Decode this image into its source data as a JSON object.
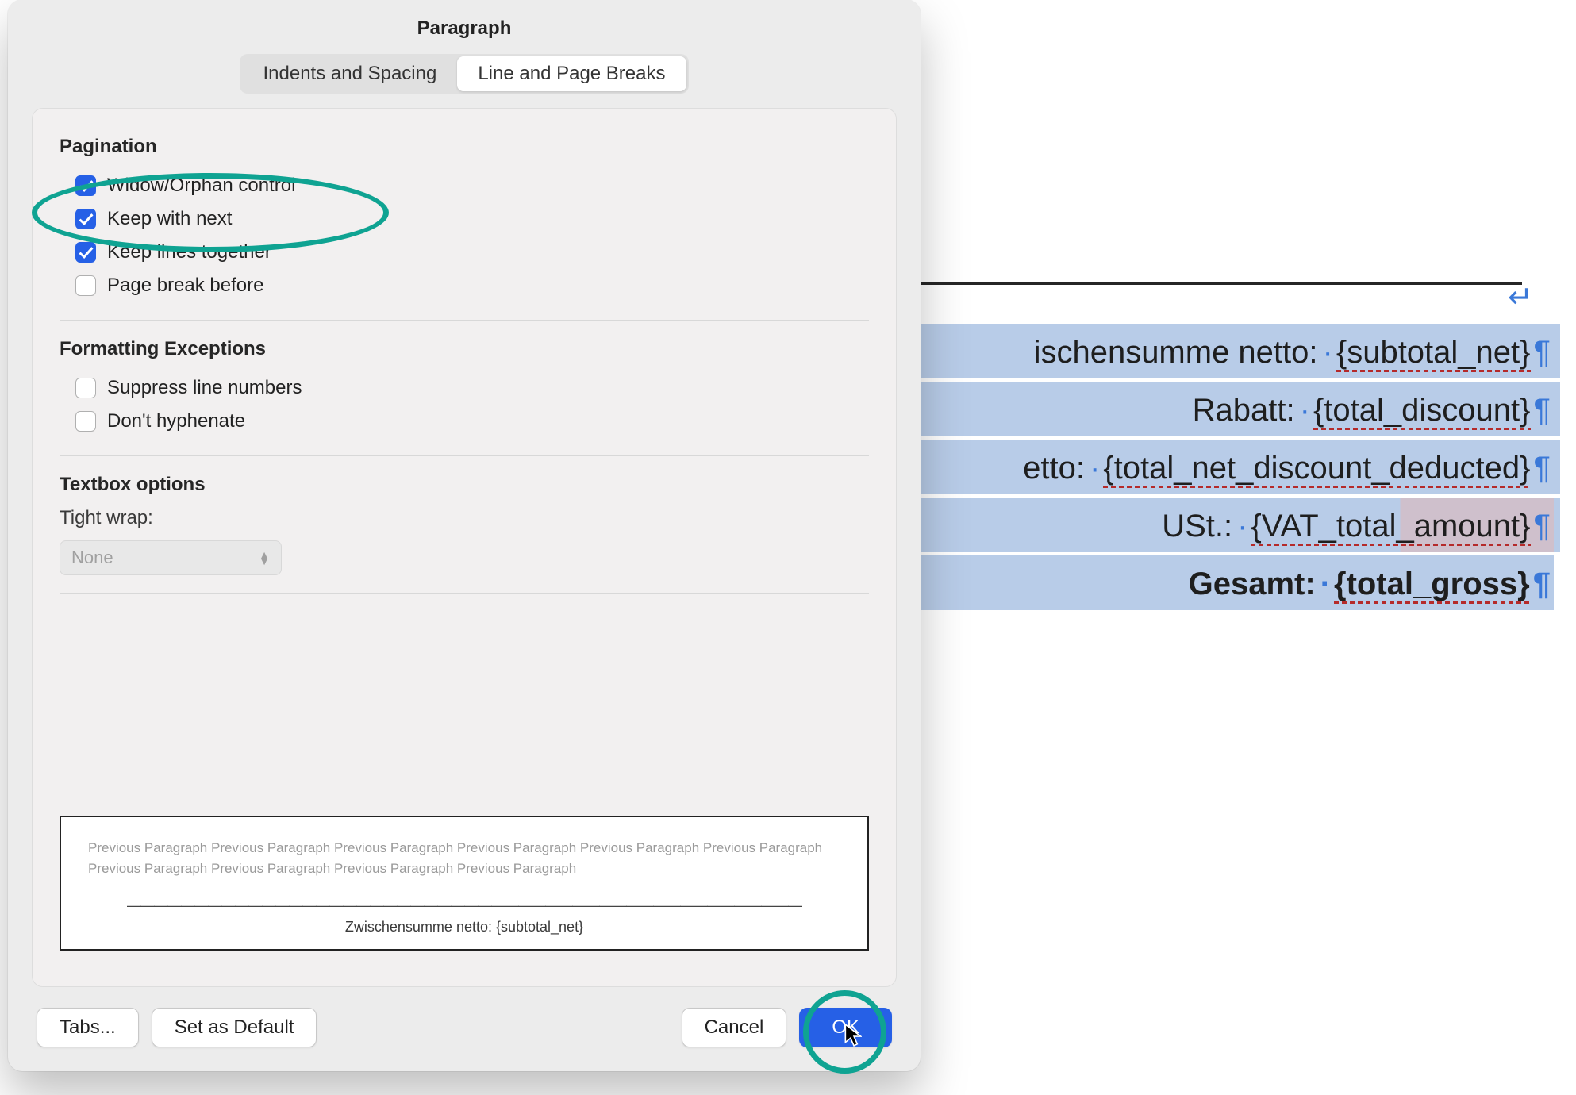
{
  "dialog": {
    "title": "Paragraph",
    "tabs": [
      {
        "label": "Indents and Spacing",
        "active": false
      },
      {
        "label": "Line and Page Breaks",
        "active": true
      }
    ],
    "pagination": {
      "header": "Pagination",
      "items": [
        {
          "label": "Widow/Orphan control",
          "checked": true
        },
        {
          "label": "Keep with next",
          "checked": true
        },
        {
          "label": "Keep lines together",
          "checked": true
        },
        {
          "label": "Page break before",
          "checked": false
        }
      ]
    },
    "formatting": {
      "header": "Formatting Exceptions",
      "items": [
        {
          "label": "Suppress line numbers",
          "checked": false
        },
        {
          "label": "Don't hyphenate",
          "checked": false
        }
      ]
    },
    "textbox": {
      "header": "Textbox options",
      "tight_label": "Tight wrap:",
      "select_value": "None"
    },
    "preview": {
      "grey": "Previous Paragraph Previous Paragraph Previous Paragraph Previous Paragraph Previous Paragraph Previous Paragraph Previous Paragraph Previous Paragraph Previous Paragraph Previous Paragraph",
      "center": "Zwischensumme netto: {subtotal_net}"
    },
    "buttons": {
      "tabs": "Tabs...",
      "default": "Set as Default",
      "cancel": "Cancel",
      "ok": "OK"
    }
  },
  "doc": {
    "rows": [
      {
        "label": "ischensumme netto:",
        "placeholder": "{subtotal_net}",
        "bold": false,
        "cls": "first"
      },
      {
        "label": "Rabatt:",
        "placeholder": "{total_discount}",
        "bold": false,
        "cls": ""
      },
      {
        "label": "etto:",
        "placeholder": "{total_net_discount_deducted}",
        "bold": false,
        "cls": ""
      },
      {
        "label": "USt.:",
        "placeholder": "{VAT_total_amount}",
        "bold": false,
        "cls": "vat"
      },
      {
        "label": "Gesamt:",
        "placeholder": "{total_gross}",
        "bold": true,
        "cls": "gross"
      }
    ]
  }
}
